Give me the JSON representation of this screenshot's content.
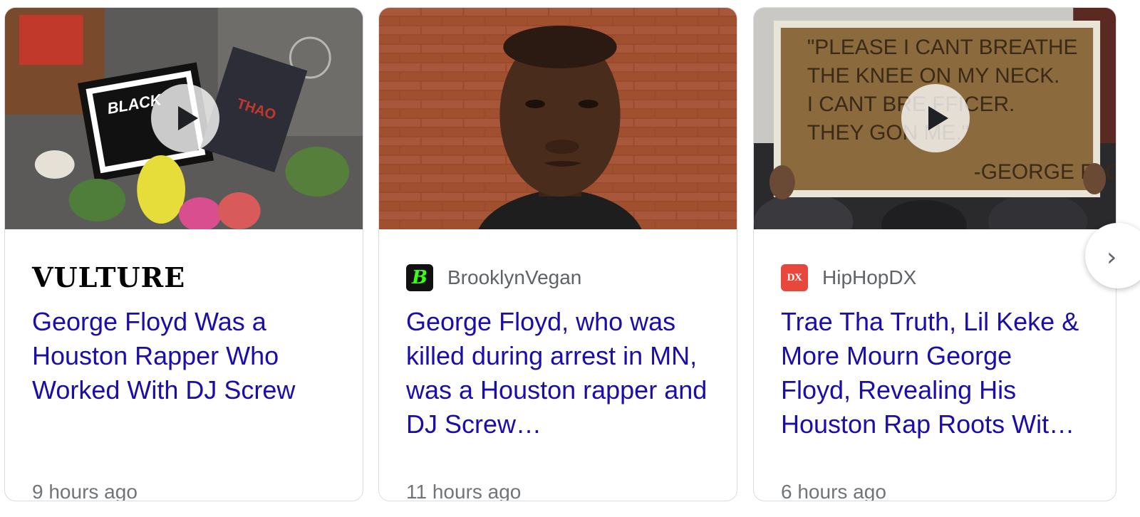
{
  "cards": [
    {
      "source": "VULTURE",
      "headline": "George Floyd Was a Houston Rapper Who Worked With DJ Screw",
      "time": "9 hours ago",
      "has_video": true,
      "thumbnail_icon": "memorial-photo",
      "sign_text": "BLACK LIVES MATTER"
    },
    {
      "source": "BrooklynVegan",
      "logo_text": "B",
      "headline": "George Floyd, who was killed during arrest in MN, was a Houston rapper and DJ Screw…",
      "time": "11 hours ago",
      "has_video": false,
      "thumbnail_icon": "portrait-photo"
    },
    {
      "source": "HipHopDX",
      "logo_text": "DX",
      "headline": "Trae Tha Truth, Lil Keke & More Mourn George Floyd, Revealing His Houston Rap Roots Wit…",
      "time": "6 hours ago",
      "has_video": true,
      "thumbnail_icon": "protest-sign-photo",
      "sign_text": "PLEASE I CANT BREATHE"
    }
  ],
  "next_button": {
    "icon": "chevron-right-icon",
    "glyph": "›"
  },
  "colors": {
    "link": "#1a0dab",
    "meta": "#70757a",
    "source": "#5f6368",
    "border": "#dadce0"
  }
}
